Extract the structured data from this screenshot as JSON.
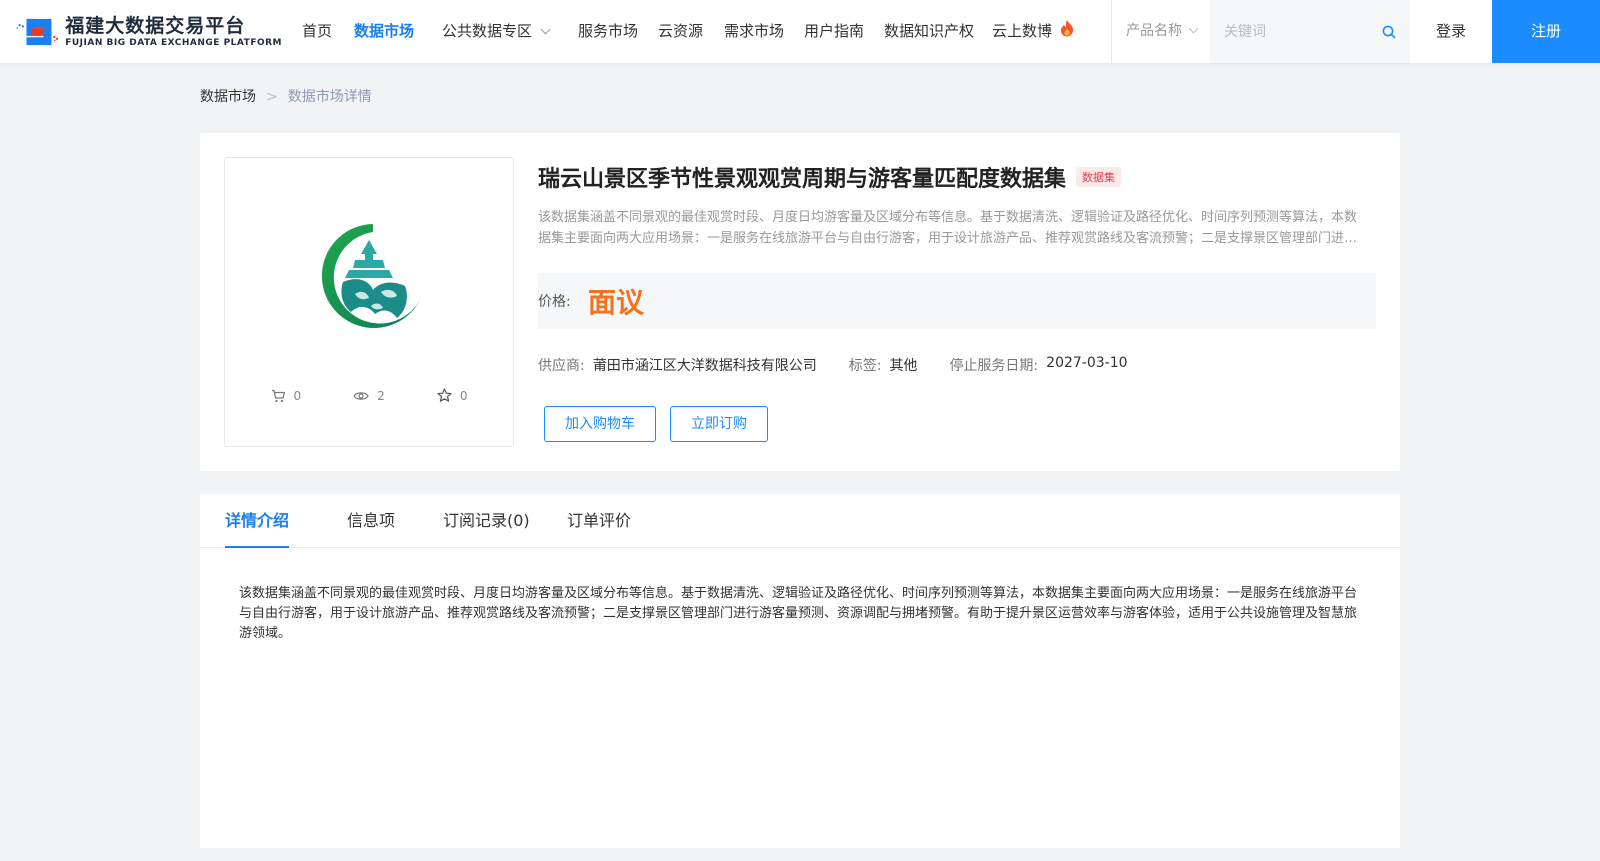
{
  "header": {
    "logo_cn": "福建大数据交易平台",
    "logo_en": "FUJIAN BIG DATA EXCHANGE  PLATFORM",
    "nav": [
      {
        "label": "首页"
      },
      {
        "label": "数据市场",
        "active": true
      },
      {
        "label": "公共数据专区",
        "dropdown": true
      },
      {
        "label": "服务市场"
      },
      {
        "label": "云资源"
      },
      {
        "label": "需求市场"
      },
      {
        "label": "用户指南"
      },
      {
        "label": "数据知识产权"
      },
      {
        "label": "云上数博",
        "icon": "fire-icon"
      }
    ],
    "search": {
      "category": "产品名称",
      "placeholder": "关键词"
    },
    "login": "登录",
    "register": "注册"
  },
  "breadcrumb": {
    "root": "数据市场",
    "separator": ">",
    "current": "数据市场详情"
  },
  "product": {
    "title": "瑞云山景区季节性景观观赏周期与游客量匹配度数据集",
    "type_badge": "数据集",
    "description": "该数据集涵盖不同景观的最佳观赏时段、月度日均游客量及区域分布等信息。基于数据清洗、逻辑验证及路径优化、时间序列预测等算法，本数据集主要面向两大应用场景：一是服务在线旅游平台与自由行游客，用于设计旅游产品、推荐观赏路线及客流预警；二是支撑景区管理部门进行游客量预测、资源调配与拥堵预警。有助于提升景区运营效率与游客体验，适用于公共设施管理及智慧旅游领域。",
    "price_label": "价格:",
    "price_value": "面议",
    "supplier_label": "供应商:",
    "supplier": "莆田市涵江区大洋数据科技有限公司",
    "tag_label": "标签:",
    "tag": "其他",
    "end_date_label": "停止服务日期:",
    "end_date": "2027-03-10",
    "stats": {
      "cart_count": "0",
      "view_count": "2",
      "favorite_count": "0"
    },
    "add_cart": "加入购物车",
    "buy_now": "立即订购"
  },
  "detail": {
    "tabs": [
      {
        "label": "详情介绍",
        "active": true
      },
      {
        "label": "信息项"
      },
      {
        "label": "订阅记录(0)"
      },
      {
        "label": "订单评价"
      }
    ],
    "text": "该数据集涵盖不同景观的最佳观赏时段、月度日均游客量及区域分布等信息。基于数据清洗、逻辑验证及路径优化、时间序列预测等算法，本数据集主要面向两大应用场景：一是服务在线旅游平台与自由行游客，用于设计旅游产品、推荐观赏路线及客流预警；二是支撑景区管理部门进行游客量预测、资源调配与拥堵预警。有助于提升景区运营效率与游客体验，适用于公共设施管理及智慧旅游领域。"
  },
  "colors": {
    "accent": "#1a8cff",
    "price": "#f5731f",
    "badge_bg": "#fde8ea",
    "badge_text": "#e53e4f"
  }
}
